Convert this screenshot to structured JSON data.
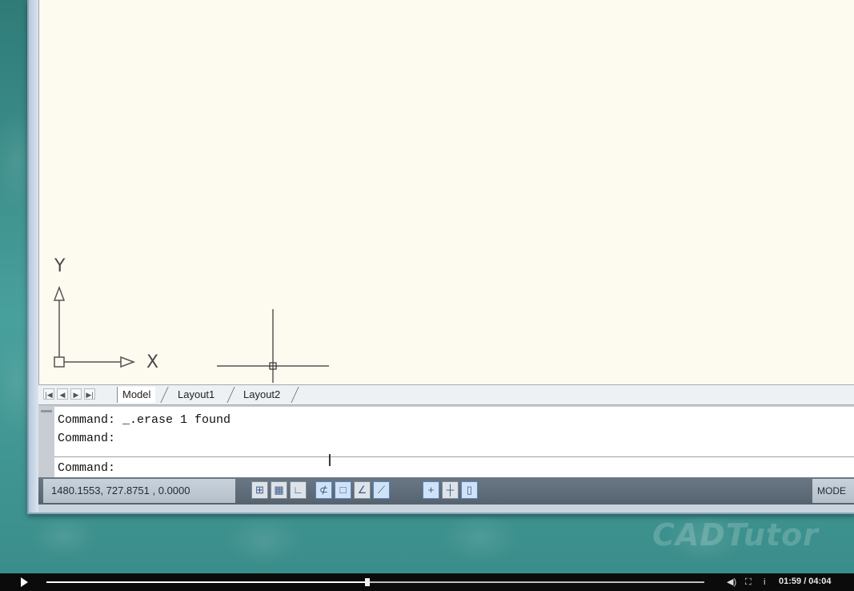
{
  "watermark": "CADTutor",
  "canvas": {
    "ucs_y": "Y",
    "ucs_x": "X"
  },
  "tabs": {
    "nav_first": "|◀",
    "nav_prev": "◀",
    "nav_next": "▶",
    "nav_last": "▶|",
    "items": [
      {
        "label": "Model",
        "active": true
      },
      {
        "label": "Layout1",
        "active": false
      },
      {
        "label": "Layout2",
        "active": false
      }
    ]
  },
  "command": {
    "history": [
      "Command: _.erase 1 found",
      "Command:"
    ],
    "prompt": "Command:"
  },
  "status": {
    "coordinates": "1480.1553, 727.8751 , 0.0000",
    "buttons": [
      {
        "name": "snap",
        "icon": "snap-icon",
        "glyph": "⊞",
        "on": false
      },
      {
        "name": "grid",
        "icon": "grid-icon",
        "glyph": "▦",
        "on": false
      },
      {
        "name": "ortho",
        "icon": "ortho-icon",
        "glyph": "∟",
        "on": false
      },
      {
        "name": "polar",
        "icon": "polar-icon",
        "glyph": "⊄",
        "on": true
      },
      {
        "name": "osnap",
        "icon": "osnap-icon",
        "glyph": "□",
        "on": true
      },
      {
        "name": "otrack",
        "icon": "otrack-icon",
        "glyph": "∠",
        "on": false
      },
      {
        "name": "ducs",
        "icon": "ducs-icon",
        "glyph": "⟋",
        "on": true
      },
      {
        "name": "dyn",
        "icon": "dyn-icon",
        "glyph": "+",
        "on": true
      },
      {
        "name": "lwt",
        "icon": "lwt-icon",
        "glyph": "┼",
        "on": false
      },
      {
        "name": "qp",
        "icon": "qp-icon",
        "glyph": "▯",
        "on": true
      }
    ],
    "space": "MODE"
  },
  "player": {
    "progress": 0.488,
    "time": "01:59 / 04:04",
    "volume_icon": "◀)",
    "fullscreen_icon": "⛶",
    "info_icon": "i"
  },
  "colors": {
    "canvas": "#fdfaf0",
    "background": "#3f8f8c",
    "statusbar": "#5c6975"
  }
}
